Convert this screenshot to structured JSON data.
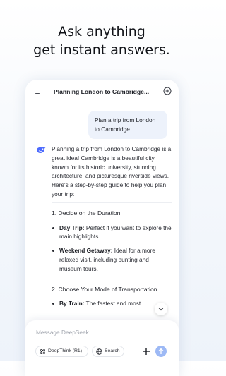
{
  "headline": {
    "line1": "Ask anything",
    "line2": "get instant answers."
  },
  "chat": {
    "title": "Planning London to Cambridge..."
  },
  "user_message": "Plan a trip from London to Cambridge.",
  "assistant": {
    "intro": "Planning a trip from London to Cambridge is a great idea! Cambridge is a beautiful city known for its historic university, stunning architecture, and picturesque riverside views. Here's a step-by-step guide to help you plan your trip:",
    "section1_title": "1. Decide on the Duration",
    "bullets1": [
      {
        "label": "Day Trip:",
        "text": " Perfect if you want to explore the main highlights."
      },
      {
        "label": "Weekend Getaway:",
        "text": " Ideal for a more relaxed visit, including punting and museum tours."
      }
    ],
    "section2_title": "2. Choose Your Mode of Transportation",
    "bullets2": [
      {
        "label": "By Train:",
        "text": " The fastest and most"
      }
    ]
  },
  "composer": {
    "placeholder": "Message DeepSeek",
    "deepthink_label": "DeepThink (R1)",
    "search_label": "Search"
  },
  "colors": {
    "accent": "#4d6bfe",
    "send_disabled": "#9db9f5",
    "bubble": "#edf2fb"
  }
}
